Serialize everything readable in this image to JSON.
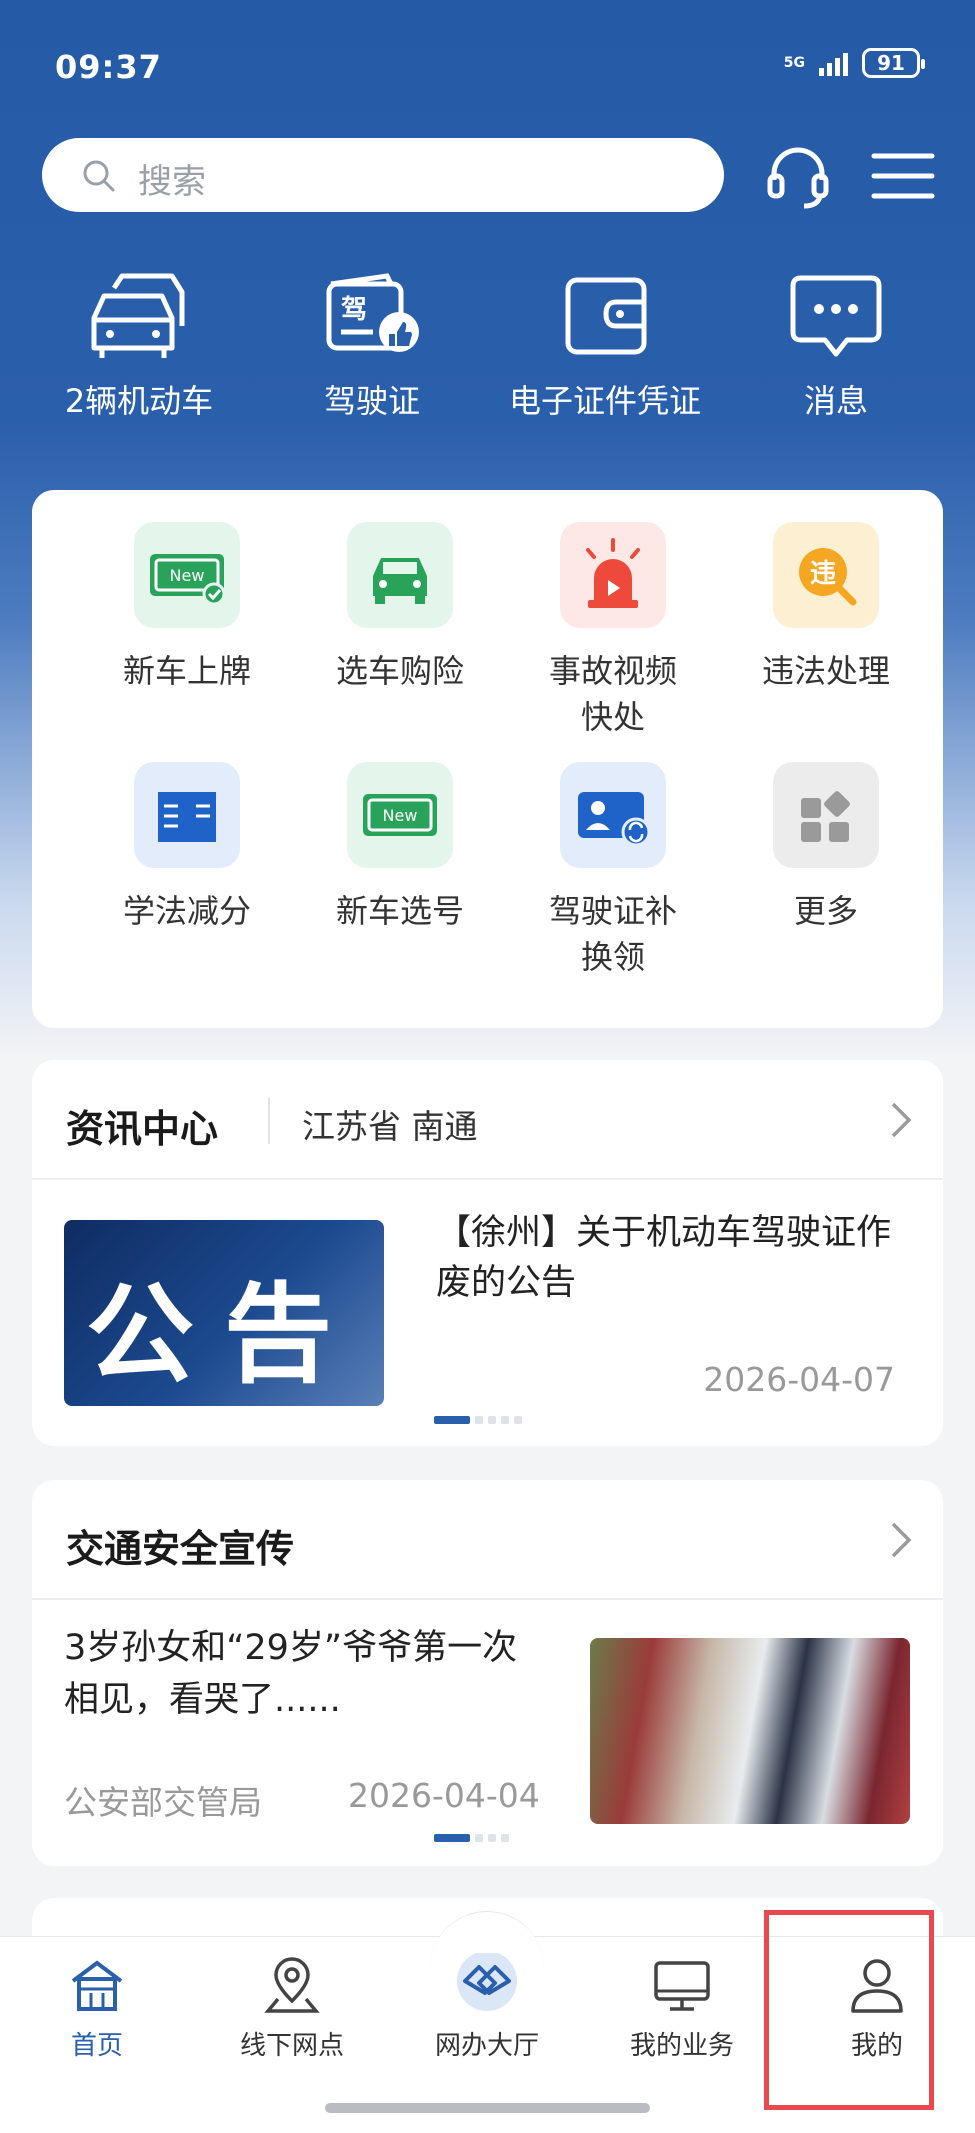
{
  "status": {
    "time": "09:37",
    "network": "5G",
    "battery": "91"
  },
  "search": {
    "placeholder": "搜索"
  },
  "header_icons": [
    "headset-icon",
    "menu-icon"
  ],
  "quick_actions": [
    {
      "label": "2辆机动车",
      "icon": "car-icon"
    },
    {
      "label": "驾驶证",
      "icon": "license-icon"
    },
    {
      "label": "电子证件凭证",
      "icon": "wallet-icon"
    },
    {
      "label": "消息",
      "icon": "message-icon"
    }
  ],
  "services": [
    {
      "label": "新车上牌",
      "icon": "new-plate-icon"
    },
    {
      "label": "选车购险",
      "icon": "car-insurance-icon"
    },
    {
      "label": "事故视频\n快处",
      "icon": "alarm-icon"
    },
    {
      "label": "违法处理",
      "icon": "violation-icon"
    },
    {
      "label": "学法减分",
      "icon": "book-icon"
    },
    {
      "label": "新车选号",
      "icon": "plate-select-icon"
    },
    {
      "label": "驾驶证补\n换领",
      "icon": "license-renew-icon"
    },
    {
      "label": "更多",
      "icon": "more-icon"
    }
  ],
  "news": {
    "title": "资讯中心",
    "location": "江苏省 南通",
    "image_text": "公告",
    "item_title": "【徐州】关于机动车驾驶证作废的公告",
    "item_date": "2026-04-07"
  },
  "safety": {
    "title": "交通安全宣传",
    "item_title": "3岁孙女和“29岁”爷爷第一次相见，看哭了......",
    "item_source": "公安部交管局",
    "item_date": "2026-04-04"
  },
  "tabs": [
    {
      "label": "首页",
      "active": true
    },
    {
      "label": "线下网点",
      "active": false
    },
    {
      "label": "网办大厅",
      "active": false
    },
    {
      "label": "我的业务",
      "active": false
    },
    {
      "label": "我的",
      "active": false
    }
  ],
  "colors": {
    "primary": "#2a5fab",
    "highlight": "#e8484f"
  }
}
